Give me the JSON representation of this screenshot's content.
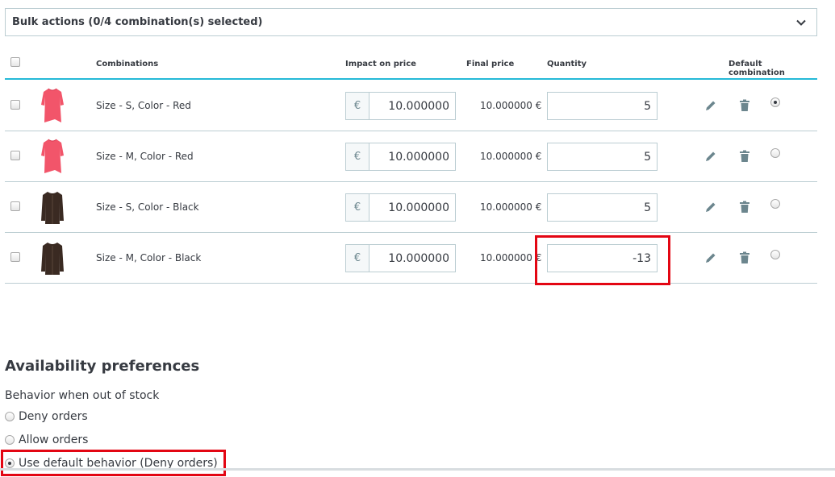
{
  "bulk": {
    "label": "Bulk actions (0/4 combination(s) selected)"
  },
  "table": {
    "headers": {
      "combinations": "Combinations",
      "impact": "Impact on price",
      "final": "Final price",
      "quantity": "Quantity",
      "default": "Default combination"
    },
    "rows": [
      {
        "name": "Size - S, Color - Red",
        "currency": "€",
        "impact": "10.000000",
        "final": "10.000000 €",
        "qty": "5",
        "thumb": "red-dress",
        "is_default": true
      },
      {
        "name": "Size - M, Color - Red",
        "currency": "€",
        "impact": "10.000000",
        "final": "10.000000 €",
        "qty": "5",
        "thumb": "red-dress",
        "is_default": false
      },
      {
        "name": "Size - S, Color - Black",
        "currency": "€",
        "impact": "10.000000",
        "final": "10.000000 €",
        "qty": "5",
        "thumb": "black-cardigan",
        "is_default": false
      },
      {
        "name": "Size - M, Color - Black",
        "currency": "€",
        "impact": "10.000000",
        "final": "10.000000 €",
        "qty": "-13",
        "thumb": "black-cardigan",
        "is_default": false
      }
    ]
  },
  "availability": {
    "title": "Availability preferences",
    "behavior_label": "Behavior when out of stock",
    "options": [
      {
        "label": "Deny orders",
        "checked": false
      },
      {
        "label": "Allow orders",
        "checked": false
      },
      {
        "label": "Use default behavior (Deny orders)",
        "checked": true
      }
    ]
  },
  "colors": {
    "accent": "#25b9d7",
    "highlight": "#e30613",
    "border": "#bbcdd2",
    "red_product": "#f2556a",
    "black_product": "#3a2a22"
  },
  "icons": [
    "chevron-down-icon",
    "edit-icon",
    "trash-icon"
  ]
}
